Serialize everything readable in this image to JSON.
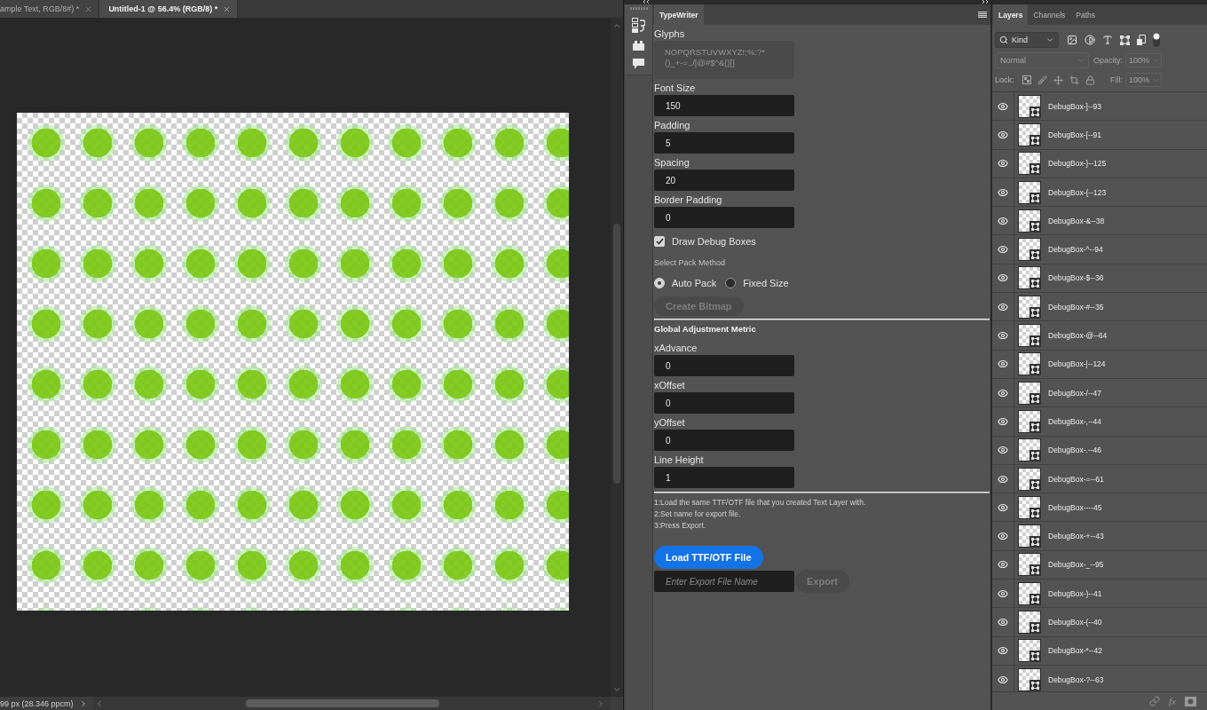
{
  "document_tabs": [
    {
      "title": "ample Text, RGB/8#) *",
      "selected": false
    },
    {
      "title": "Untitled-1 @ 56.4% (RGB/8) *",
      "selected": true
    }
  ],
  "status_bar": {
    "info": "99 px (28.346 ppcm)"
  },
  "typewriter_panel": {
    "tabs": [
      {
        "label": "TypeWriter",
        "selected": true
      }
    ],
    "glyphs": {
      "label": "Glyphs",
      "lines": [
        "NOPQRSTUVWXYZ!;%:?*",
        "()_+-=.,/|@#$^&{}[]"
      ]
    },
    "fields": [
      {
        "label": "Font Size",
        "value": "150"
      },
      {
        "label": "Padding",
        "value": "5"
      },
      {
        "label": "Spacing",
        "value": "20"
      },
      {
        "label": "Border Padding",
        "value": "0"
      }
    ],
    "debug_boxes": {
      "label": "Draw Debug Boxes",
      "checked": true
    },
    "pack_method": {
      "label": "Select Pack Method",
      "options": [
        {
          "label": "Auto Pack",
          "selected": true
        },
        {
          "label": "Fixed Size",
          "selected": false
        }
      ]
    },
    "create_button": {
      "label": "Create Bitmap",
      "disabled": true
    },
    "adjustment": {
      "title": "Global Adjustment Metric",
      "fields": [
        {
          "label": "xAdvance",
          "value": "0"
        },
        {
          "label": "xOffset",
          "value": "0"
        },
        {
          "label": "yOffset",
          "value": "0"
        },
        {
          "label": "Line Height",
          "value": "1"
        }
      ]
    },
    "instructions": [
      "1:Load the same TTF/OTF file that you created Text Layer with.",
      "2:Set name for export file.",
      "3:Press Export."
    ],
    "load_button": {
      "label": "Load TTF/OTF File",
      "disabled": false
    },
    "export_name": {
      "placeholder": "Enter Export File Name"
    },
    "export_button": {
      "label": "Export",
      "disabled": true
    }
  },
  "layers_panel": {
    "tabs": [
      {
        "label": "Layers",
        "selected": true
      },
      {
        "label": "Channels",
        "selected": false
      },
      {
        "label": "Paths",
        "selected": false
      }
    ],
    "filter": {
      "value": "Kind"
    },
    "blend_mode": {
      "value": "Normal",
      "disabled": true
    },
    "opacity": {
      "label": "Opacity:",
      "value": "100%",
      "disabled": true
    },
    "lock": {
      "label": "Lock:"
    },
    "fill": {
      "label": "Fill:",
      "value": "100%",
      "disabled": true
    },
    "layers": [
      {
        "name": "DebugBox-]--93",
        "visible": true,
        "selected": false
      },
      {
        "name": "DebugBox-[--91",
        "visible": true,
        "selected": false
      },
      {
        "name": "DebugBox-}--125",
        "visible": true,
        "selected": false
      },
      {
        "name": "DebugBox-{--123",
        "visible": true,
        "selected": false
      },
      {
        "name": "DebugBox-&--38",
        "visible": true,
        "selected": false
      },
      {
        "name": "DebugBox-^--94",
        "visible": true,
        "selected": false
      },
      {
        "name": "DebugBox-$--36",
        "visible": true,
        "selected": false
      },
      {
        "name": "DebugBox-#--35",
        "visible": true,
        "selected": false
      },
      {
        "name": "DebugBox-@--64",
        "visible": true,
        "selected": false
      },
      {
        "name": "DebugBox-|--124",
        "visible": true,
        "selected": false
      },
      {
        "name": "DebugBox-/--47",
        "visible": true,
        "selected": false
      },
      {
        "name": "DebugBox-,--44",
        "visible": true,
        "selected": false
      },
      {
        "name": "DebugBox-.--46",
        "visible": true,
        "selected": false
      },
      {
        "name": "DebugBox-=--61",
        "visible": true,
        "selected": false
      },
      {
        "name": "DebugBox----45",
        "visible": true,
        "selected": false
      },
      {
        "name": "DebugBox-+--43",
        "visible": true,
        "selected": false
      },
      {
        "name": "DebugBox-_--95",
        "visible": true,
        "selected": false
      },
      {
        "name": "DebugBox-)--41",
        "visible": true,
        "selected": false
      },
      {
        "name": "DebugBox-(--40",
        "visible": true,
        "selected": false
      },
      {
        "name": "DebugBox-*--42",
        "visible": true,
        "selected": false
      },
      {
        "name": "DebugBox-?--63",
        "visible": true,
        "selected": false
      }
    ],
    "footer": {
      "effects_label": "fx"
    }
  }
}
